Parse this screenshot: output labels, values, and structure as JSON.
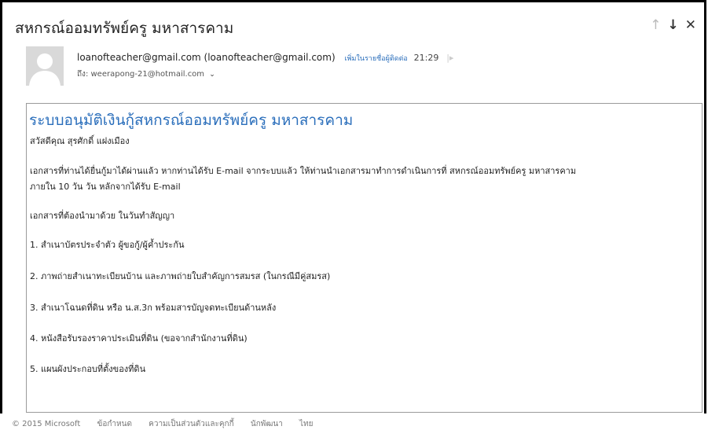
{
  "email": {
    "subject": "สหกรณ์ออมทรัพย์ครู มหาสารคาม",
    "nav_up": "↑",
    "nav_down": "↓",
    "nav_close": "✕",
    "sender_display": "loanofteacher@gmail.com (loanofteacher@gmail.com)",
    "add_contact": "เพิ่มในรายชื่อผู้ติดต่อ",
    "time": "21:29",
    "flag": "|▸",
    "to_label": "ถึง:",
    "to_address": "weerapong-21@hotmail.com",
    "to_chevron": "⌄"
  },
  "body": {
    "title": "ระบบอนุมัติเงินกู้สหกรณ์ออมทรัพย์ครู มหาสารคาม",
    "greeting": "สวัสดีคุณ สุรศักดิ์ แฝงเมือง",
    "para1_line1": "เอกสารที่ท่านได้ยื่นกู้มาได้ผ่านแล้ว หากท่านได้รับ E-mail จากระบบแล้ว ให้ท่านนำเอกสารมาทำการดำเนินการที่ สหกรณ์ออมทรัพย์ครู มหาสารคาม",
    "para1_line2": "ภายใน 10 วัน วัน หลักจากได้รับ E-mail",
    "docs_heading": "เอกสารที่ต้องนำมาด้วย ในวันทำสัญญา",
    "items": [
      "1. สำเนาบัตรประจำตัว ผู้ขอกู้/ผู้ค้ำประกัน",
      "2. ภาพถ่ายสำเนาทะเบียนบ้าน และภาพถ่ายใบสำคัญการสมรส (ในกรณีมีคู่สมรส)",
      "3. สำเนาโฉนดที่ดิน หรือ น.ส.3ก พร้อมสารบัญจดทะเบียนด้านหลัง",
      "4. หนังสือรับรองราคาประเมินที่ดิน (ขอจากสำนักงานที่ดิน)",
      "5. แผนผังประกอบที่ตั้งของที่ดิน"
    ]
  },
  "footer": {
    "copyright": "© 2015 Microsoft",
    "terms": "ข้อกำหนด",
    "privacy": "ความเป็นส่วนตัวและคุกกี้",
    "developers": "นักพัฒนา",
    "language": "ไทย"
  },
  "colors": {
    "accent": "#2a6ebb",
    "avatar_bg": "#d9d9d9",
    "body_border": "#9a9a9a"
  }
}
